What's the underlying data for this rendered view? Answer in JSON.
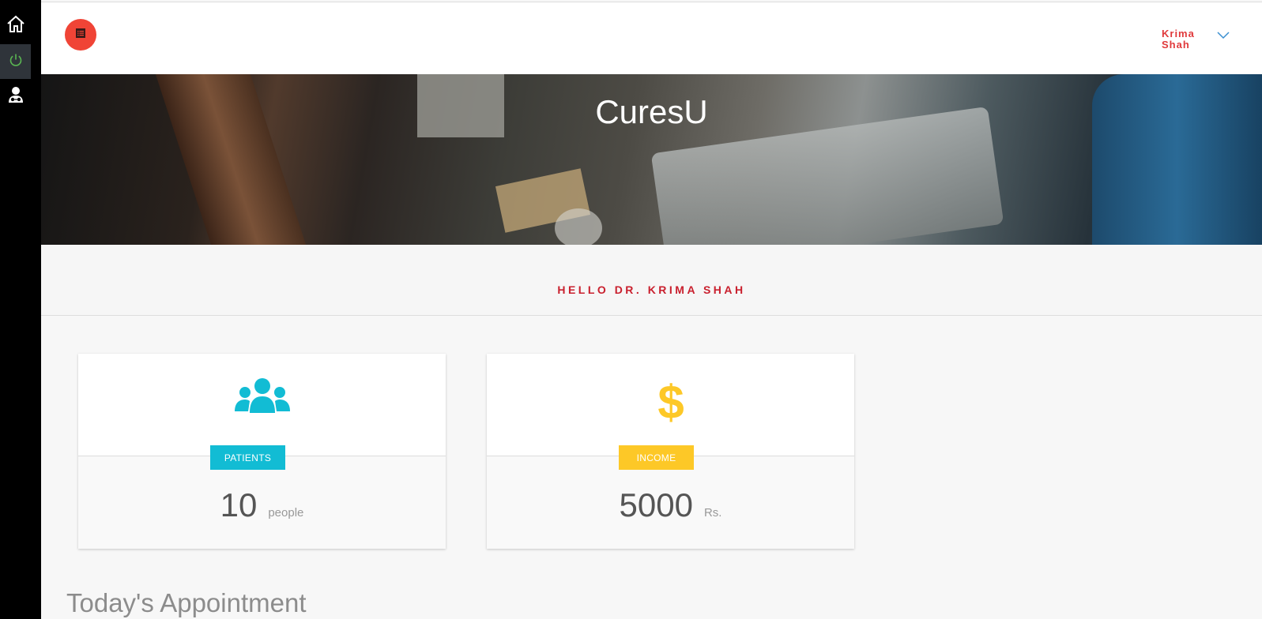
{
  "sidebar": {
    "items": [
      {
        "icon": "home-icon",
        "active": false
      },
      {
        "icon": "power-icon",
        "active": true
      },
      {
        "icon": "doctor-icon",
        "active": false
      }
    ]
  },
  "header": {
    "menu_icon": "list-icon",
    "user_name": "Krima Shah"
  },
  "hero": {
    "title": "CuresU"
  },
  "greeting": "HELLO DR. KRIMA SHAH",
  "cards": [
    {
      "icon": "users-icon",
      "label": "PATIENTS",
      "value": "10",
      "unit": "people",
      "color": "#12bcd4"
    },
    {
      "icon": "dollar-icon",
      "label": "INCOME",
      "value": "5000",
      "unit": "Rs.",
      "color": "#fdc827"
    }
  ],
  "appointments": {
    "title": "Today's Appointment"
  },
  "colors": {
    "accent_red": "#f04436",
    "greeting_red": "#c9202e",
    "patients": "#12bcd4",
    "income": "#fdc827",
    "sidebar_bg": "#000000",
    "power_icon": "#5ab552"
  }
}
